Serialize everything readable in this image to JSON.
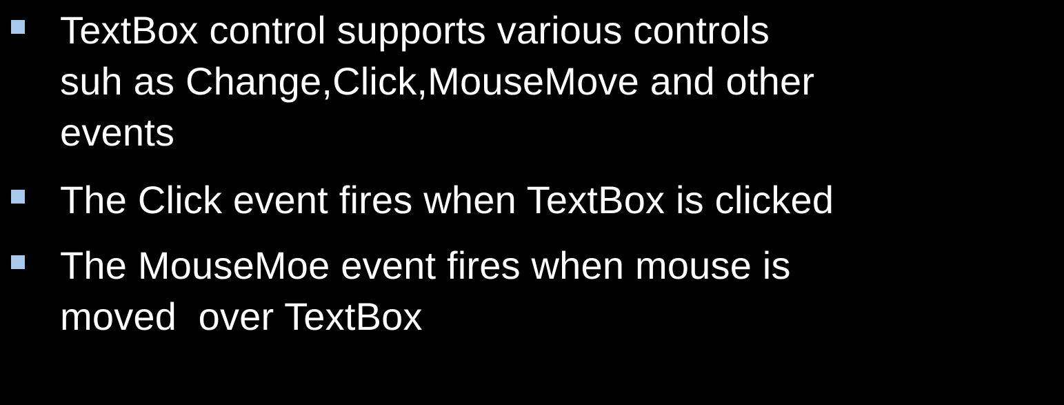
{
  "slide": {
    "bullet_color": "#a9c9ec",
    "text_color": "#ffffff",
    "background_color": "#000000",
    "bullets": [
      {
        "lines": [
          "TextBox control supports various controls",
          "suh as Change,Click,MouseMove and other",
          "events"
        ]
      },
      {
        "lines": [
          "The Click event fires when TextBox is clicked"
        ]
      },
      {
        "lines": [
          "The MouseMoe event fires when mouse is",
          "moved  over TextBox"
        ]
      }
    ]
  }
}
